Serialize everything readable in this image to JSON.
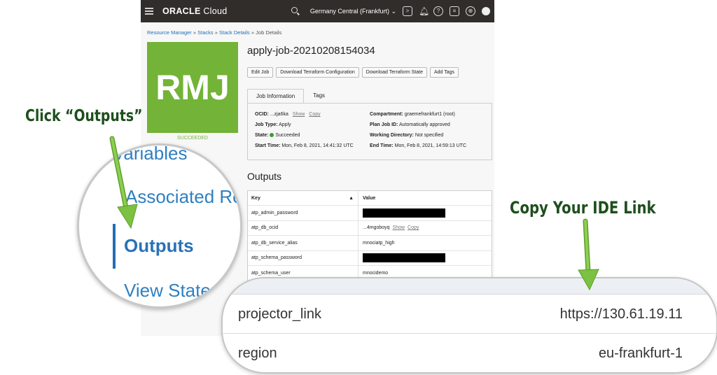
{
  "topbar": {
    "logo_main": "ORACLE",
    "logo_sub": "Cloud",
    "region": "Germany Central (Frankfurt) ⌄"
  },
  "breadcrumb": {
    "items": [
      "Resource Manager",
      "Stacks",
      "Stack Details"
    ],
    "current": "Job Details",
    "separator": "»"
  },
  "job": {
    "tile": "RMJ",
    "status": "SUCCEEDED",
    "title": "apply-job-20210208154034",
    "buttons": [
      "Edit Job",
      "Download Terraform Configuration",
      "Download Terraform State",
      "Add Tags"
    ],
    "tabs": [
      "Job Information",
      "Tags"
    ]
  },
  "info": {
    "ocid_label": "OCID:",
    "ocid_value": "...zja6ka",
    "show": "Show",
    "copy": "Copy",
    "job_type_label": "Job Type:",
    "job_type_value": "Apply",
    "state_label": "State:",
    "state_value": "Succeeded",
    "start_label": "Start Time:",
    "start_value": "Mon, Feb 8, 2021, 14:41:32 UTC",
    "compartment_label": "Compartment:",
    "compartment_value": "graemefrankfurt1 (root)",
    "plan_label": "Plan Job ID:",
    "plan_value": "Automatically approved",
    "workdir_label": "Working Directory:",
    "workdir_value": "Not specified",
    "end_label": "End Time:",
    "end_value": "Mon, Feb 8, 2021, 14:59:13 UTC"
  },
  "outputs": {
    "title": "Outputs",
    "col_key": "Key",
    "col_value": "Value",
    "sort_icon": "▲",
    "rows": [
      {
        "key": "atp_admin_password",
        "value": ""
      },
      {
        "key": "atp_db_ocid",
        "value": "...4mgoboyq"
      },
      {
        "key": "atp_db_service_alias",
        "value": "mnociatp_high"
      },
      {
        "key": "atp_schema_password",
        "value": ""
      },
      {
        "key": "atp_schema_user",
        "value": "mnocidemo"
      }
    ],
    "show": "Show",
    "copy": "Copy"
  },
  "magnifier": {
    "partial_top": "Variables",
    "partial_item": "Associated Resources",
    "outputs": "Outputs",
    "view_state": "View State"
  },
  "zoom_rows": [
    {
      "key": "projector_link",
      "value": "https://130.61.19.11"
    },
    {
      "key": "region",
      "value": "eu-frankfurt-1"
    }
  ],
  "callouts": {
    "left": "Click “Outputs”",
    "right": "Copy Your IDE Link"
  },
  "colors": {
    "topbar": "#312d2a",
    "tile": "#73b337",
    "link": "#1f70b5",
    "arrow": "#7bc142",
    "callout": "#1e4f1d"
  }
}
